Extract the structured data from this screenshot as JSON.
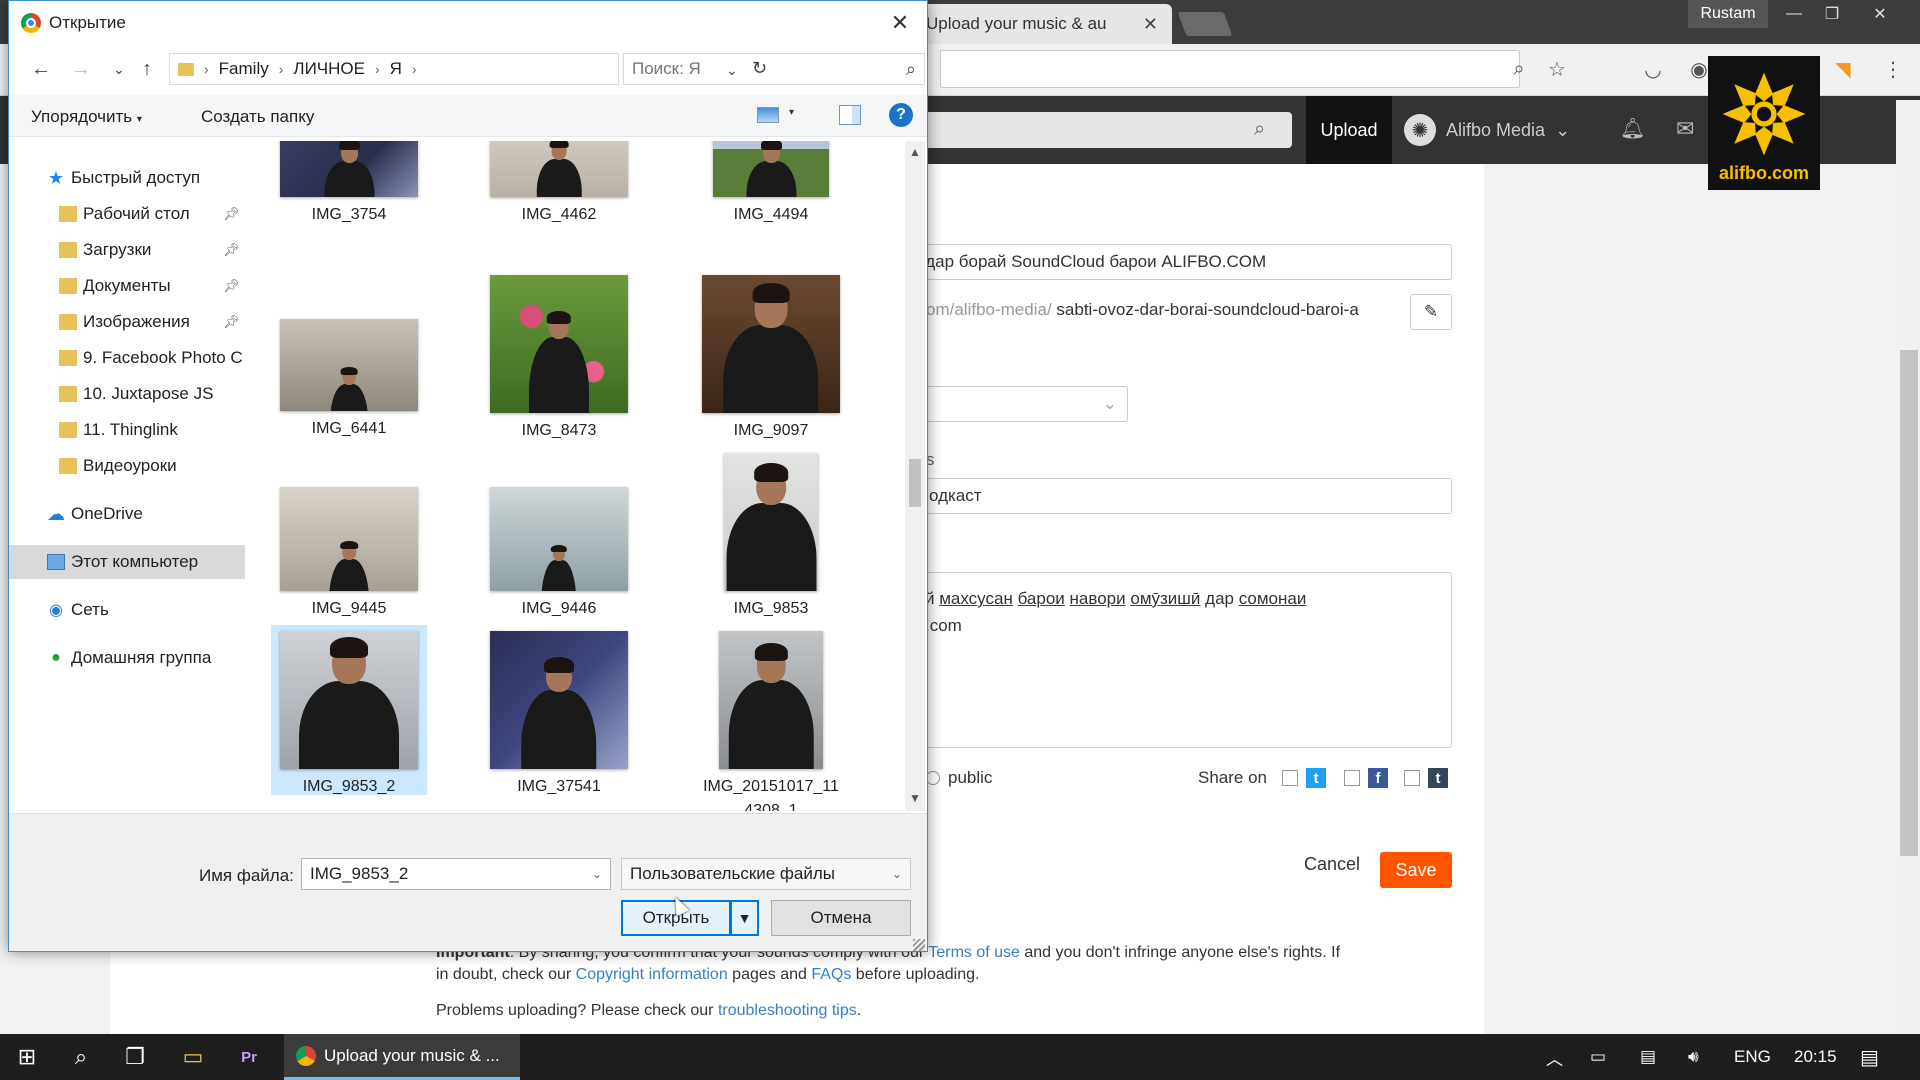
{
  "browser": {
    "tab_title": "Upload your music & au",
    "user": "Rustam"
  },
  "soundcloud": {
    "upload_label": "Upload",
    "user_name": "Alifbo Media",
    "logo_text": "alifbo.com",
    "title_value": "й дар борай SoundCloud барои ALIFBO.COM",
    "permalink_prefix": "om/alifbo-media/",
    "permalink_slug": "sabti-ovoz-dar-borai-soundcloud-baroi-a",
    "tags_label": "s",
    "tags_value": "одкаст",
    "desc_line1_parts": [
      "й ",
      "махсусан",
      " ",
      "барои",
      " ",
      "навори",
      " ",
      "омӯзишӣ",
      " дар ",
      "сомонаи"
    ],
    "desc_line2": ".com",
    "privacy_label": "public",
    "share_on_label": "Share on",
    "cancel_label": "Cancel",
    "save_label": "Save",
    "footer": {
      "important_label": "Important",
      "line1_text_a": ": By sharing, you confirm that your sounds comply with our ",
      "terms_link": "Terms of use",
      "line1_text_b": " and you don't infringe anyone else's rights. If",
      "line2_text_a": "in doubt, check our ",
      "copyright_link": "Copyright information",
      "line2_text_b": " pages and ",
      "faqs_link": "FAQs",
      "line2_text_c": " before uploading.",
      "line3_text_a": "Problems uploading? Please check our ",
      "troubleshoot_link": "troubleshooting tips",
      "line3_text_b": "."
    }
  },
  "dialog": {
    "title": "Открытие",
    "breadcrumb": [
      "Family",
      "ЛИЧНОЕ",
      "Я"
    ],
    "search_placeholder": "Поиск: Я",
    "organize_label": "Упорядочить",
    "new_folder_label": "Создать папку",
    "help_label": "?",
    "nav_items": [
      {
        "label": "Быстрый доступ",
        "icon": "star-icon"
      },
      {
        "label": "Рабочий стол",
        "icon": "folder-icon",
        "pinned": true
      },
      {
        "label": "Загрузки",
        "icon": "folder-icon",
        "pinned": true
      },
      {
        "label": "Документы",
        "icon": "folder-icon",
        "pinned": true
      },
      {
        "label": "Изображения",
        "icon": "folder-icon",
        "pinned": true
      },
      {
        "label": "9. Facebook Photo C",
        "icon": "folder-icon"
      },
      {
        "label": "10. Juxtapose JS",
        "icon": "folder-icon"
      },
      {
        "label": "11. Thinglink",
        "icon": "folder-icon"
      },
      {
        "label": "Видеоуроки",
        "icon": "folder-icon"
      },
      {
        "label": "OneDrive",
        "icon": "cloud-icon"
      },
      {
        "label": "Этот компьютер",
        "icon": "computer-icon",
        "selected": true
      },
      {
        "label": "Сеть",
        "icon": "network-icon"
      },
      {
        "label": "Домашняя группа",
        "icon": "homegroup-icon"
      }
    ],
    "files": [
      {
        "name": "IMG_3754"
      },
      {
        "name": "IMG_4462"
      },
      {
        "name": "IMG_4494"
      },
      {
        "name": "IMG_6441"
      },
      {
        "name": "IMG_8473"
      },
      {
        "name": "IMG_9097"
      },
      {
        "name": "IMG_9445"
      },
      {
        "name": "IMG_9446"
      },
      {
        "name": "IMG_9853"
      },
      {
        "name": "IMG_9853_2",
        "selected": true
      },
      {
        "name": "IMG_37541"
      },
      {
        "name": "IMG_20151017_114308_1"
      }
    ],
    "file_name_label": "Имя файла:",
    "file_name_value": "IMG_9853_2",
    "file_type_value": "Пользовательские файлы",
    "open_label": "Открыть",
    "cancel_label": "Отмена"
  },
  "taskbar": {
    "chrome_label": "Upload your music & ...",
    "language": "ENG",
    "time": "20:15"
  },
  "colors": {
    "accent_orange": "#ff5500",
    "dialog_border": "#3c8dcc",
    "selection": "#cce8ff"
  }
}
